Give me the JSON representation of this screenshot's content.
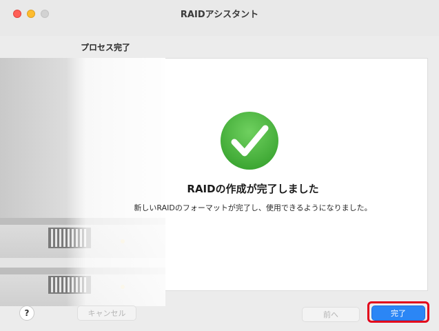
{
  "window": {
    "title": "RAIDアシスタント"
  },
  "section": {
    "title": "プロセス完了"
  },
  "result": {
    "heading": "RAIDの作成が完了しました",
    "message": "新しいRAIDのフォーマットが完了し、使用できるようになりました。",
    "icon": "checkmark-circle-icon"
  },
  "buttons": {
    "help": "?",
    "cancel": "キャンセル",
    "previous": "前へ",
    "done": "完了"
  },
  "colors": {
    "accent": "#2b86f5",
    "success": "#46b03b",
    "highlight": "#e2001a"
  }
}
